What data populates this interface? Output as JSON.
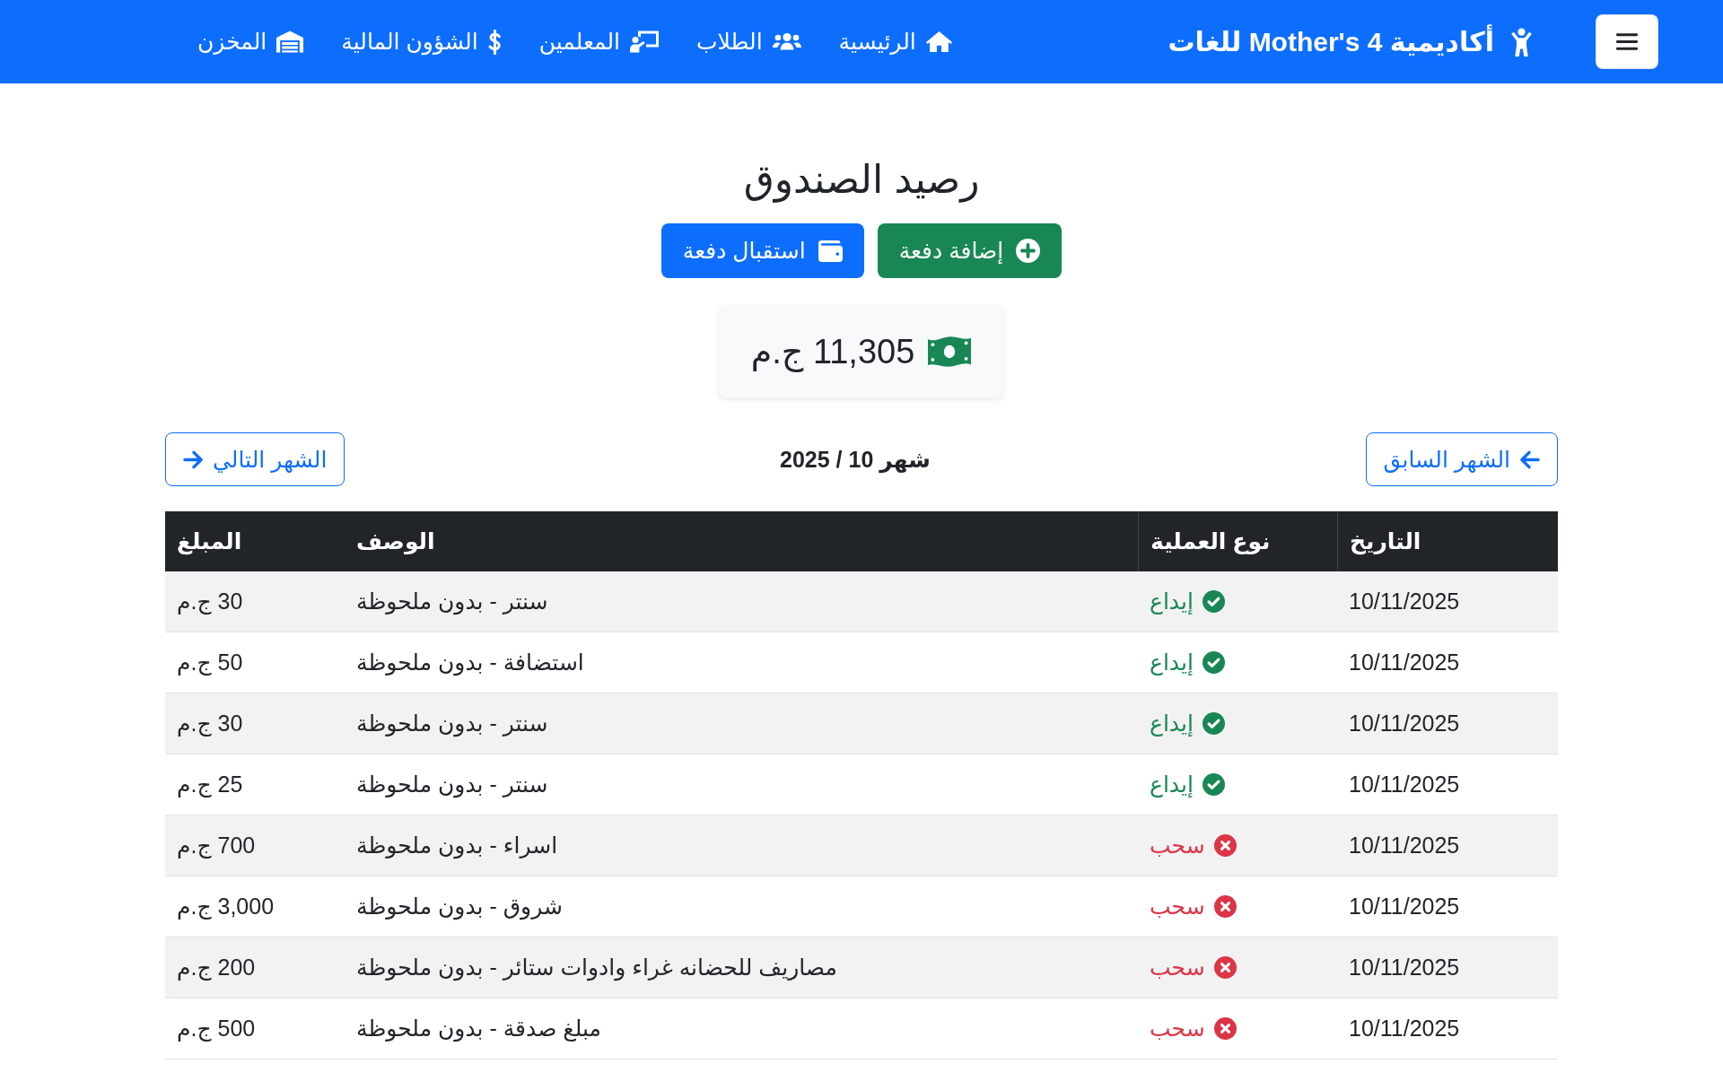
{
  "navbar": {
    "brand": "أكاديمية Mother's 4 للغات",
    "links": [
      "الرئيسية",
      "الطلاب",
      "المعلمين",
      "الشؤون المالية",
      "المخزن"
    ]
  },
  "title": "رصيد الصندوق",
  "actions": [
    {
      "kind": "add",
      "label": "إضافة دفعة"
    },
    {
      "kind": "receive",
      "label": "استقبال دفعة"
    }
  ],
  "balance": {
    "amount": "11,305 ج.م"
  },
  "month_nav": {
    "previous": "الشهر السابق",
    "current": "شهر 10 / 2025",
    "next": "الشهر التالي"
  },
  "table": {
    "columns": [
      "التاريخ",
      "نوع العملية",
      "الوصف",
      "المبلغ"
    ],
    "rows": [
      {
        "kind": "deposit",
        "date": "10/11/2025",
        "type": "إيداع",
        "description": "سنتر - بدون ملحوظة",
        "amount": "30 ج.م"
      },
      {
        "kind": "deposit",
        "date": "10/11/2025",
        "type": "إيداع",
        "description": "استضافة - بدون ملحوظة",
        "amount": "50 ج.م"
      },
      {
        "kind": "deposit",
        "date": "10/11/2025",
        "type": "إيداع",
        "description": "سنتر - بدون ملحوظة",
        "amount": "30 ج.م"
      },
      {
        "kind": "deposit",
        "date": "10/11/2025",
        "type": "إيداع",
        "description": "سنتر - بدون ملحوظة",
        "amount": "25 ج.م"
      },
      {
        "kind": "withdrawal",
        "date": "10/11/2025",
        "type": "سحب",
        "description": "اسراء - بدون ملحوظة",
        "amount": "700 ج.م"
      },
      {
        "kind": "withdrawal",
        "date": "10/11/2025",
        "type": "سحب",
        "description": "شروق - بدون ملحوظة",
        "amount": "3,000 ج.م"
      },
      {
        "kind": "withdrawal",
        "date": "10/11/2025",
        "type": "سحب",
        "description": "مصاريف للحضانه غراء وادوات ستائر - بدون ملحوظة",
        "amount": "200 ج.م"
      },
      {
        "kind": "withdrawal",
        "date": "10/11/2025",
        "type": "سحب",
        "description": "مبلغ صدقة - بدون ملحوظة",
        "amount": "500 ج.م"
      }
    ]
  }
}
